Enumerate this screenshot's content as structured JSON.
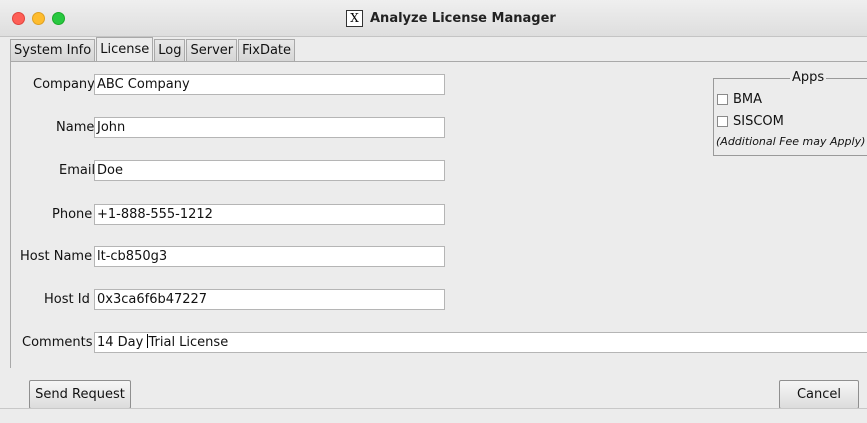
{
  "window": {
    "title": "Analyze License Manager",
    "logo_glyph": "X"
  },
  "tabs": [
    "System Info",
    "License",
    "Log",
    "Server",
    "FixDate"
  ],
  "active_tab": "License",
  "form": {
    "company": {
      "label": "Company",
      "value": "ABC Company"
    },
    "name": {
      "label": "Name",
      "value": "John"
    },
    "email": {
      "label": "Email",
      "value": "Doe"
    },
    "phone": {
      "label": "Phone",
      "value": "+1-888-555-1212"
    },
    "host_name": {
      "label": "Host Name",
      "value": "lt-cb850g3"
    },
    "host_id": {
      "label": "Host Id",
      "value": "0x3ca6f6b47227"
    },
    "comments": {
      "label": "Comments",
      "value_before_caret": "14 Day ",
      "value_after_caret": "Trial License"
    }
  },
  "apps": {
    "legend": "Apps",
    "items": [
      {
        "label": "BMA",
        "checked": false
      },
      {
        "label": "SISCOM",
        "checked": false
      }
    ],
    "note": "(Additional Fee may Apply)"
  },
  "buttons": {
    "send_request": "Send Request",
    "cancel": "Cancel"
  },
  "colors": {
    "close": "#fe5f57",
    "minimize": "#febc2e",
    "zoom": "#28c840"
  }
}
